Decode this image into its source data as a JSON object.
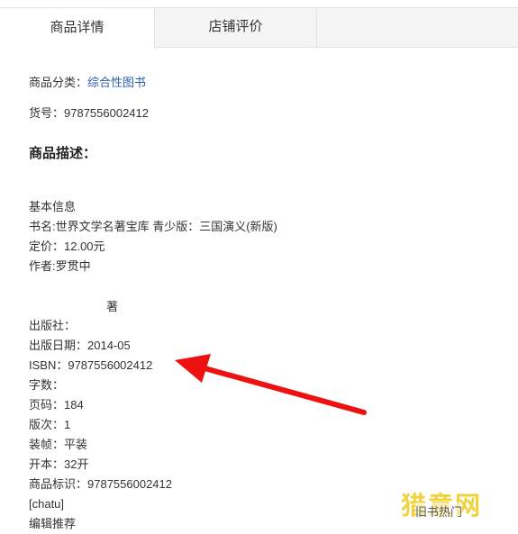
{
  "tabs": [
    {
      "label": "商品详情"
    },
    {
      "label": "店铺评价"
    }
  ],
  "info": {
    "category_label": "商品分类：",
    "category_value": "综合性图书",
    "item_no": "货号：9787556002412",
    "desc_heading": "商品描述：",
    "basic_info": "基本信息",
    "book_name": "书名:世界文学名著宝库 青少版：三国演义(新版)",
    "price": "定价：12.00元",
    "author": "作者:罗贯中",
    "zhu": "著",
    "publisher": "出版社：",
    "pub_date": "出版日期：2014-05",
    "isbn": "ISBN：9787556002412",
    "word_count": "字数：",
    "pages": "页码：184",
    "edition": "版次：1",
    "binding": "装帧：平装",
    "format": "开本：32开",
    "product_id": "商品标识：9787556002412",
    "chatu": "[chatu]",
    "editor_rec": "编辑推荐"
  },
  "watermark": {
    "logo": "猎意网",
    "sub": "旧书热门"
  },
  "colors": {
    "arrow": "#ee1111",
    "link": "#2a5ea9"
  }
}
